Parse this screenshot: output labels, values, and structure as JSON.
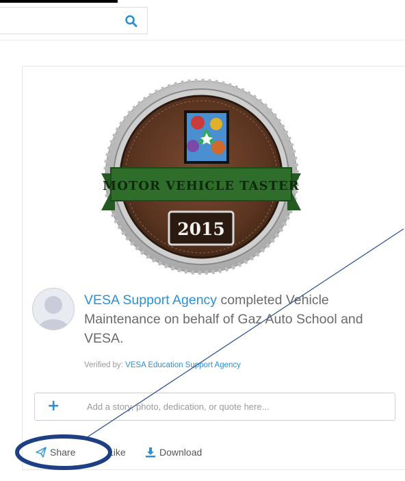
{
  "search": {
    "value": "",
    "placeholder": ""
  },
  "badge": {
    "banner_text": "MOTOR VEHICLE TASTER",
    "year": "2015"
  },
  "activity": {
    "actor": "VESA Support Agency",
    "text": " completed Vehicle Maintenance on behalf of Gaz Auto School and VESA.",
    "verified_label": "Verified by: ",
    "verified_link": "VESA Education Support Agency"
  },
  "story": {
    "plus": "+",
    "placeholder": "Add a story, photo, dedication, or quote here..."
  },
  "actions": {
    "share": "Share",
    "like": "Like",
    "download": "Download"
  },
  "colors": {
    "link": "#2b8fd6",
    "annotation": "#1e3f84",
    "banner_green": "#2f6e2a"
  },
  "icons": [
    "search-icon",
    "share-icon",
    "download-icon",
    "avatar-placeholder-icon"
  ]
}
